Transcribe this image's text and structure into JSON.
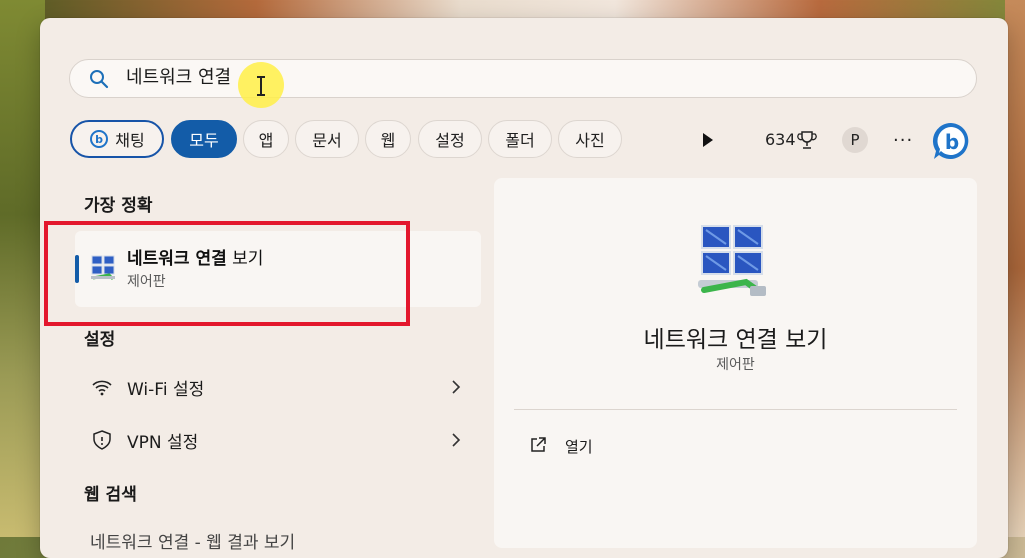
{
  "search": {
    "query": "네트워크 연결"
  },
  "filters": {
    "chat": "채팅",
    "items": [
      "모두",
      "앱",
      "문서",
      "웹",
      "설정",
      "폴더",
      "사진"
    ]
  },
  "toolbar": {
    "points": "634",
    "avatar_letter": "P",
    "more": "···"
  },
  "sections": {
    "best_match": "가장 정확",
    "settings": "설정",
    "web_search": "웹 검색"
  },
  "best_match": {
    "title_bold": "네트워크 연결",
    "title_rest": " 보기",
    "subtitle": "제어판"
  },
  "settings_items": [
    {
      "label": "Wi-Fi 설정",
      "icon": "wifi-icon"
    },
    {
      "label": "VPN 설정",
      "icon": "shield-icon"
    }
  ],
  "web_partial": "네트워크 연결 - 웹 결과 보기",
  "detail": {
    "title": "네트워크 연결 보기",
    "subtitle": "제어판",
    "open_label": "열기"
  },
  "colors": {
    "accent": "#135ca8",
    "highlight_box": "#e3172d"
  }
}
